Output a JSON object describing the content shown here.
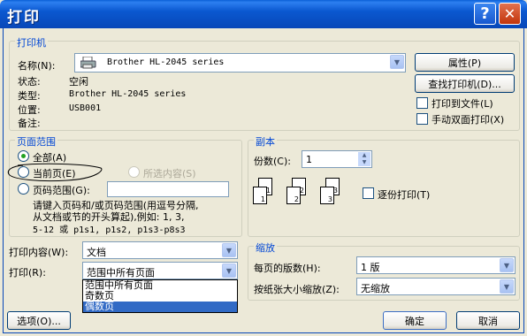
{
  "window": {
    "title": "打印",
    "help": "?",
    "close": "✕"
  },
  "printer": {
    "legend": "打印机",
    "name_label": "名称(N):",
    "name_value": "Brother HL-2045 series",
    "status_label": "状态:",
    "status_value": "空闲",
    "type_label": "类型:",
    "type_value": "Brother HL-2045 series",
    "location_label": "位置:",
    "location_value": "USB001",
    "comment_label": "备注:",
    "properties_btn": "属性(P)",
    "find_btn": "查找打印机(D)...",
    "print_to_file": "打印到文件(L)",
    "duplex": "手动双面打印(X)"
  },
  "range": {
    "legend": "页面范围",
    "all": "全部(A)",
    "current": "当前页(E)",
    "selection": "所选内容(S)",
    "pages": "页码范围(G):",
    "hint1": "请键入页码和/或页码范围(用逗号分隔,",
    "hint2": "从文档或节的开头算起),例如: 1, 3,",
    "hint3": "5-12 或 p1s1, p1s2, p1s3-p8s3"
  },
  "copies": {
    "legend": "副本",
    "count_label": "份数(C):",
    "count_value": "1",
    "collate": "逐份打印(T)",
    "page_nums": [
      "1",
      "2",
      "3"
    ]
  },
  "print_what": {
    "label": "打印内容(W):",
    "value": "文档"
  },
  "print_scope": {
    "label": "打印(R):",
    "value": "范围中所有页面",
    "options": [
      "范围中所有页面",
      "奇数页",
      "偶数页"
    ],
    "selected_index": 2
  },
  "zoom": {
    "legend": "缩放",
    "pages_label": "每页的版数(H):",
    "pages_value": "1 版",
    "scale_label": "按纸张大小缩放(Z):",
    "scale_value": "无缩放"
  },
  "buttons": {
    "options": "选项(O)...",
    "ok": "确定",
    "cancel": "取消"
  }
}
